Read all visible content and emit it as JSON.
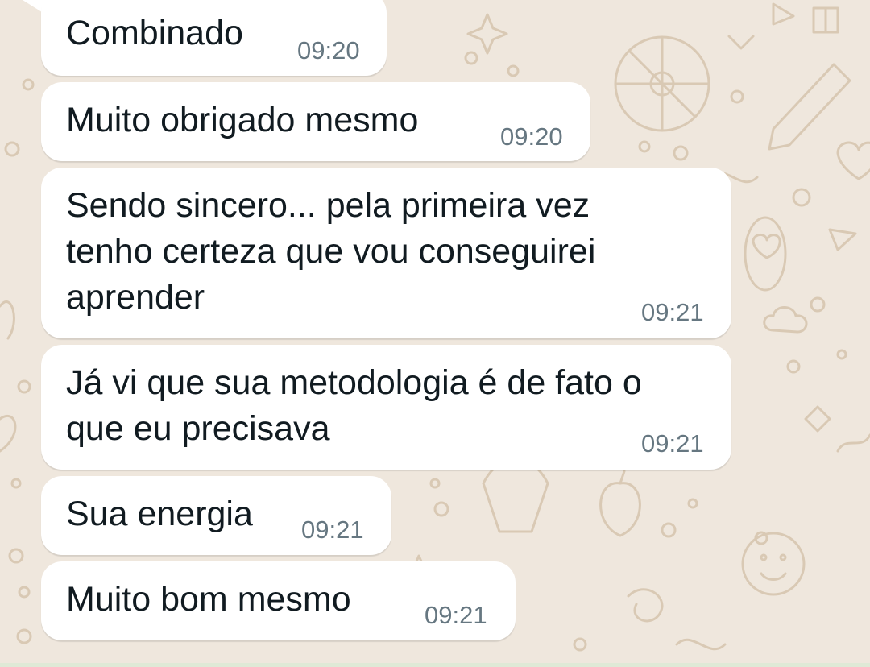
{
  "colors": {
    "wallpaper": "#efe7dd",
    "doodle": "#d9c9b4",
    "bubble": "#ffffff",
    "text": "#111b21",
    "timestamp": "#667781"
  },
  "messages": [
    {
      "lines": [
        "Combinado"
      ],
      "time": "09:20"
    },
    {
      "lines": [
        "Muito obrigado mesmo"
      ],
      "time": "09:20"
    },
    {
      "lines": [
        "Sendo sincero... pela primeira vez",
        "tenho certeza que vou conseguirei",
        "aprender"
      ],
      "time": "09:21"
    },
    {
      "lines": [
        "Já vi que sua metodologia é de fato o",
        "que eu precisava"
      ],
      "time": "09:21"
    },
    {
      "lines": [
        "Sua energia"
      ],
      "time": "09:21"
    },
    {
      "lines": [
        "Muito bom mesmo"
      ],
      "time": "09:21"
    }
  ]
}
